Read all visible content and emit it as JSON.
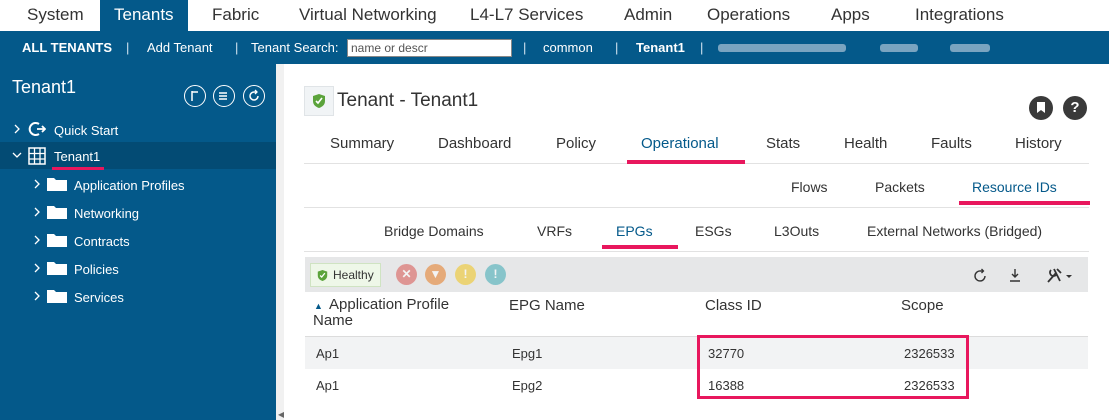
{
  "topnav": {
    "tabs": [
      "System",
      "Tenants",
      "Fabric",
      "Virtual Networking",
      "L4-L7 Services",
      "Admin",
      "Operations",
      "Apps",
      "Integrations"
    ]
  },
  "subnav": {
    "all_tenants": "ALL TENANTS",
    "add_tenant": "Add Tenant",
    "search_label": "Tenant Search:",
    "search_placeholder": "name or descr",
    "common": "common",
    "tenant1": "Tenant1",
    "separator": "|"
  },
  "sidebar": {
    "title": "Tenant1",
    "items": [
      {
        "label": "Quick Start",
        "icon": "quick-start-icon"
      },
      {
        "label": "Tenant1",
        "icon": "tenant-grid-icon"
      },
      {
        "label": "Application Profiles",
        "icon": "folder-icon"
      },
      {
        "label": "Networking",
        "icon": "folder-icon"
      },
      {
        "label": "Contracts",
        "icon": "folder-icon"
      },
      {
        "label": "Policies",
        "icon": "folder-icon"
      },
      {
        "label": "Services",
        "icon": "folder-icon"
      }
    ]
  },
  "main": {
    "title": "Tenant - Tenant1",
    "help": "?",
    "tabs": [
      "Summary",
      "Dashboard",
      "Policy",
      "Operational",
      "Stats",
      "Health",
      "Faults",
      "History"
    ],
    "subtabs": [
      "Flows",
      "Packets",
      "Resource IDs"
    ],
    "subsubtabs": [
      "Bridge Domains",
      "VRFs",
      "EPGs",
      "ESGs",
      "L3Outs",
      "External Networks (Bridged)"
    ],
    "health_badge": "Healthy",
    "faults": [
      "✕",
      "▼",
      "!",
      "!"
    ],
    "colors": {
      "nav": "#04598a",
      "accent": "#e8175d",
      "critical": "#d9534f",
      "major": "#e5791f",
      "minor": "#f0c419",
      "warning": "#3ba9b3"
    }
  },
  "table": {
    "columns": [
      "Application Profile Name",
      "EPG Name",
      "Class ID",
      "Scope"
    ],
    "sort_indicator": "▲",
    "rows": [
      {
        "ap": "Ap1",
        "epg": "Epg1",
        "class_id": "32770",
        "scope": "2326533"
      },
      {
        "ap": "Ap1",
        "epg": "Epg2",
        "class_id": "16388",
        "scope": "2326533"
      }
    ]
  }
}
